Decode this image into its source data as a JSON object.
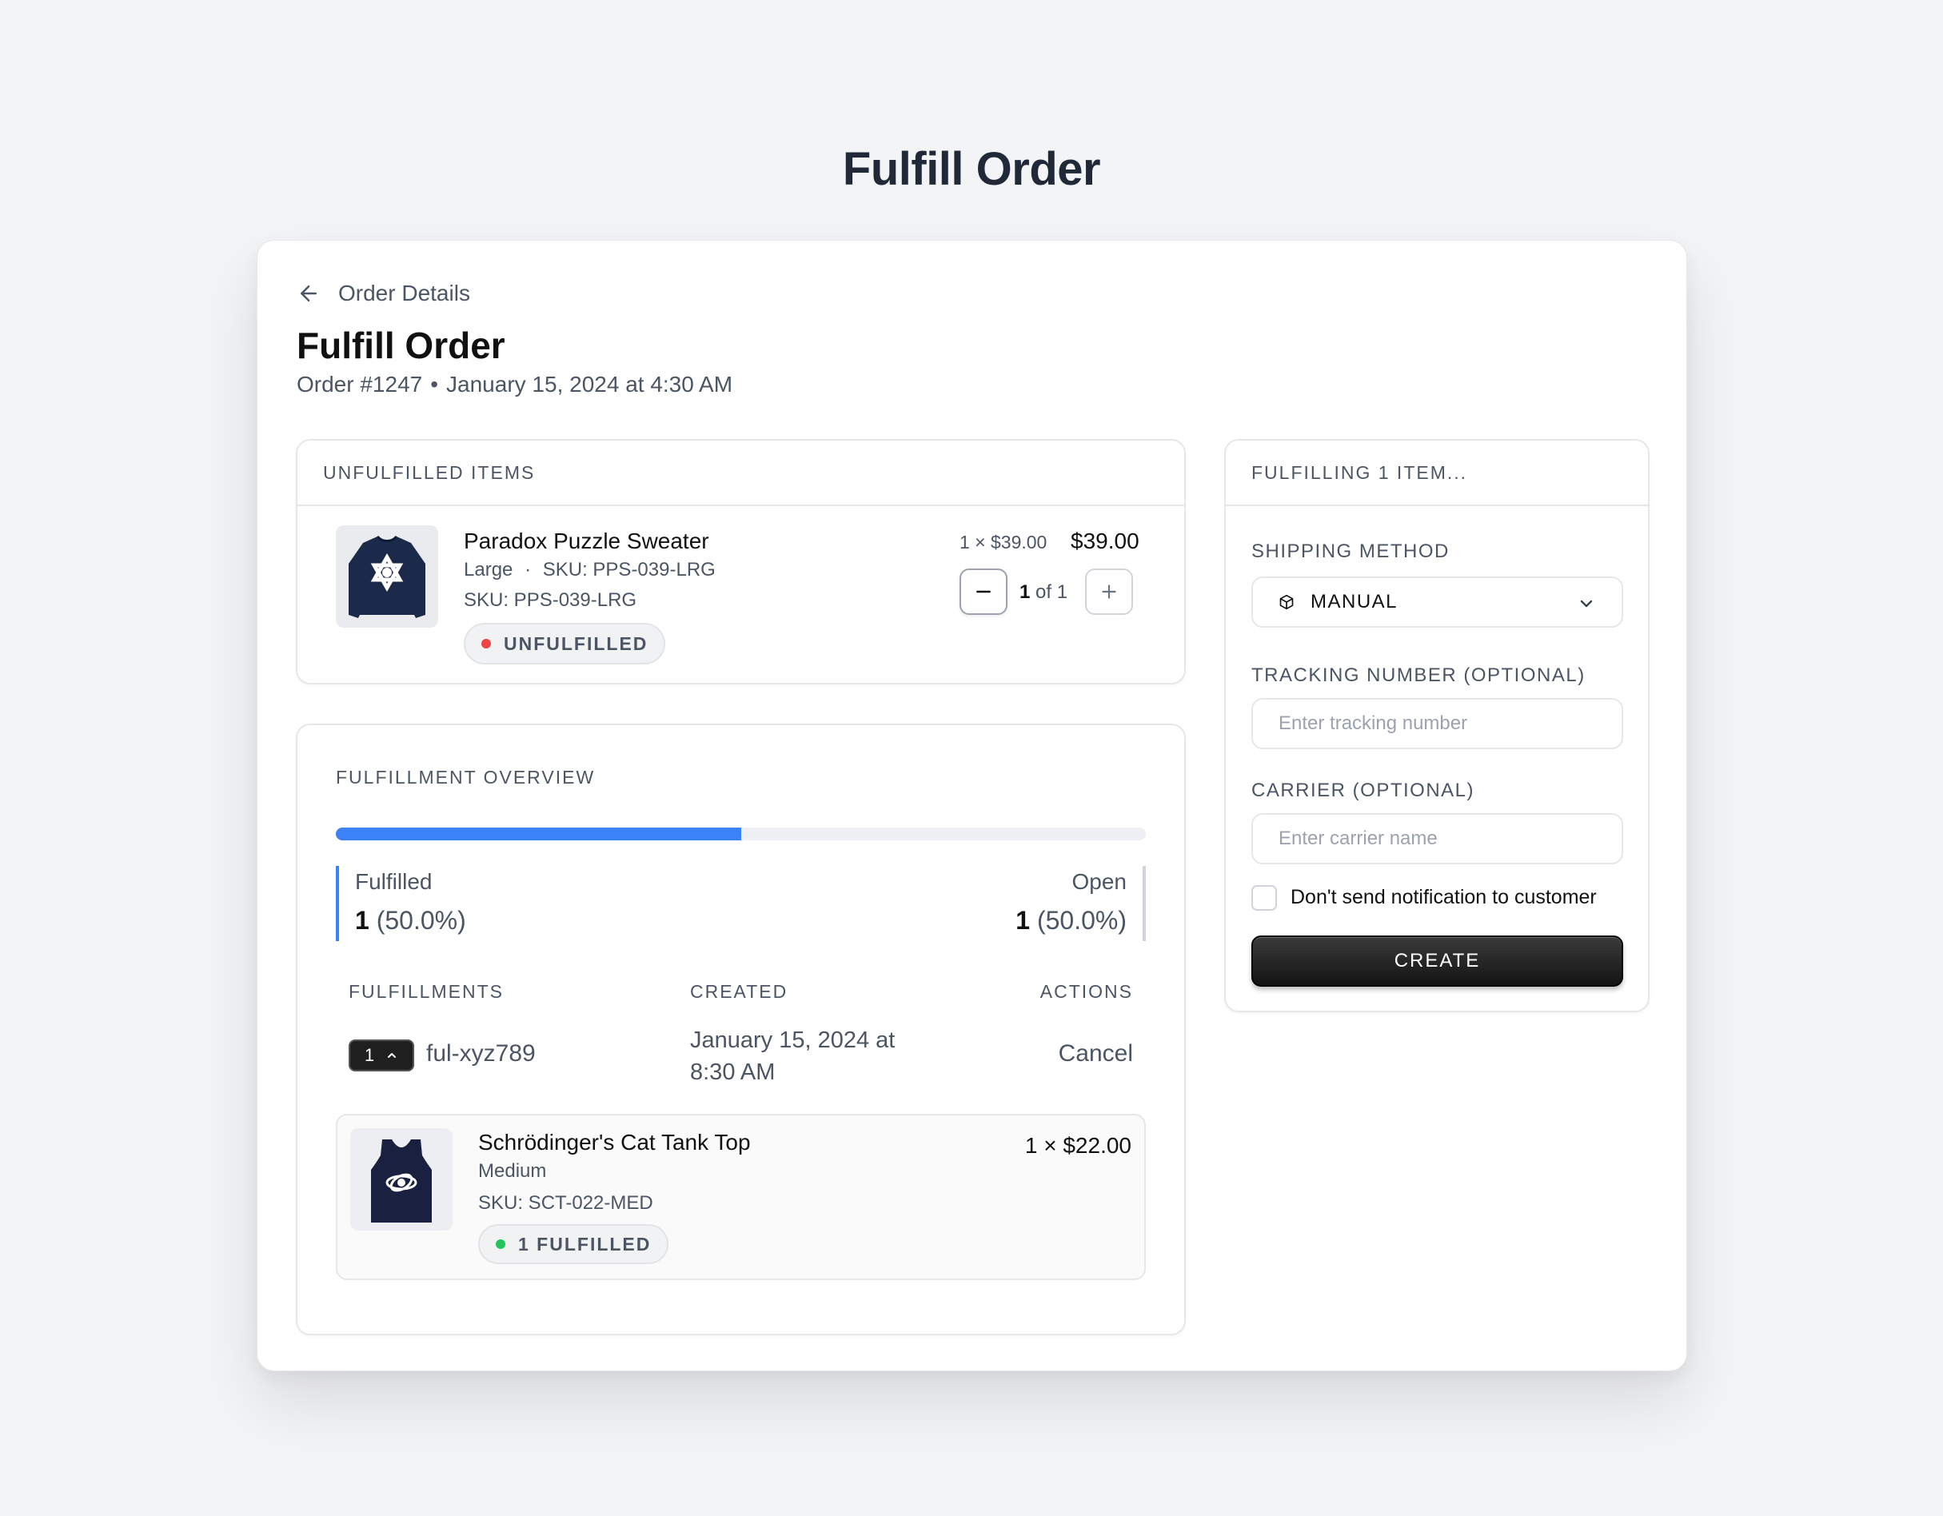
{
  "page": {
    "heading": "Fulfill Order"
  },
  "card": {
    "back_label": "Order Details",
    "title": "Fulfill Order",
    "order_number": "Order #1247",
    "separator": "•",
    "order_date": "January 15, 2024 at 4:30 AM"
  },
  "unfulfilled": {
    "heading": "UNFULFILLED ITEMS",
    "item": {
      "name": "Paradox Puzzle Sweater",
      "variant": "Large",
      "separator": "·",
      "sku_inline": "SKU: PPS-039-LRG",
      "sku": "SKU: PPS-039-LRG",
      "status": "UNFULFILLED",
      "unit_price": "1 × $39.00",
      "total": "$39.00",
      "qty_selected": "1",
      "qty_suffix": "of 1",
      "minus": "−",
      "plus": "+"
    }
  },
  "overview": {
    "heading": "FULFILLMENT OVERVIEW",
    "progress_fraction": 0.5,
    "fulfilled_label": "Fulfilled",
    "fulfilled_count": "1",
    "fulfilled_pct": "(50.0%)",
    "open_label": "Open",
    "open_count": "1",
    "open_pct": "(50.0%)",
    "columns": {
      "fulfillments": "FULFILLMENTS",
      "created": "CREATED",
      "actions": "ACTIONS"
    },
    "fulfillment": {
      "count": "1",
      "id": "ful-xyz789",
      "created": "January 15, 2024 at 8:30 AM",
      "action": "Cancel",
      "item": {
        "name": "Schrödinger's Cat Tank Top",
        "variant": "Medium",
        "sku": "SKU: SCT-022-MED",
        "status": "1 FULFILLED",
        "price": "1 × $22.00"
      }
    }
  },
  "form": {
    "heading": "FULFILLING 1 ITEM...",
    "shipping_label": "SHIPPING METHOD",
    "shipping_value": "MANUAL",
    "tracking_label": "TRACKING NUMBER (OPTIONAL)",
    "tracking_placeholder": "Enter tracking number",
    "carrier_label": "CARRIER (OPTIONAL)",
    "carrier_placeholder": "Enter carrier name",
    "notify_label": "Don't send notification to customer",
    "submit_label": "CREATE"
  },
  "colors": {
    "accent": "#3b82f6",
    "status_unfulfilled": "#ef4444",
    "status_fulfilled": "#22c55e",
    "button_dark": "#1f1f1f"
  },
  "icons": [
    "arrow-left-icon",
    "minus-icon",
    "plus-icon",
    "chevron-up-icon",
    "package-icon",
    "chevron-down-icon"
  ]
}
